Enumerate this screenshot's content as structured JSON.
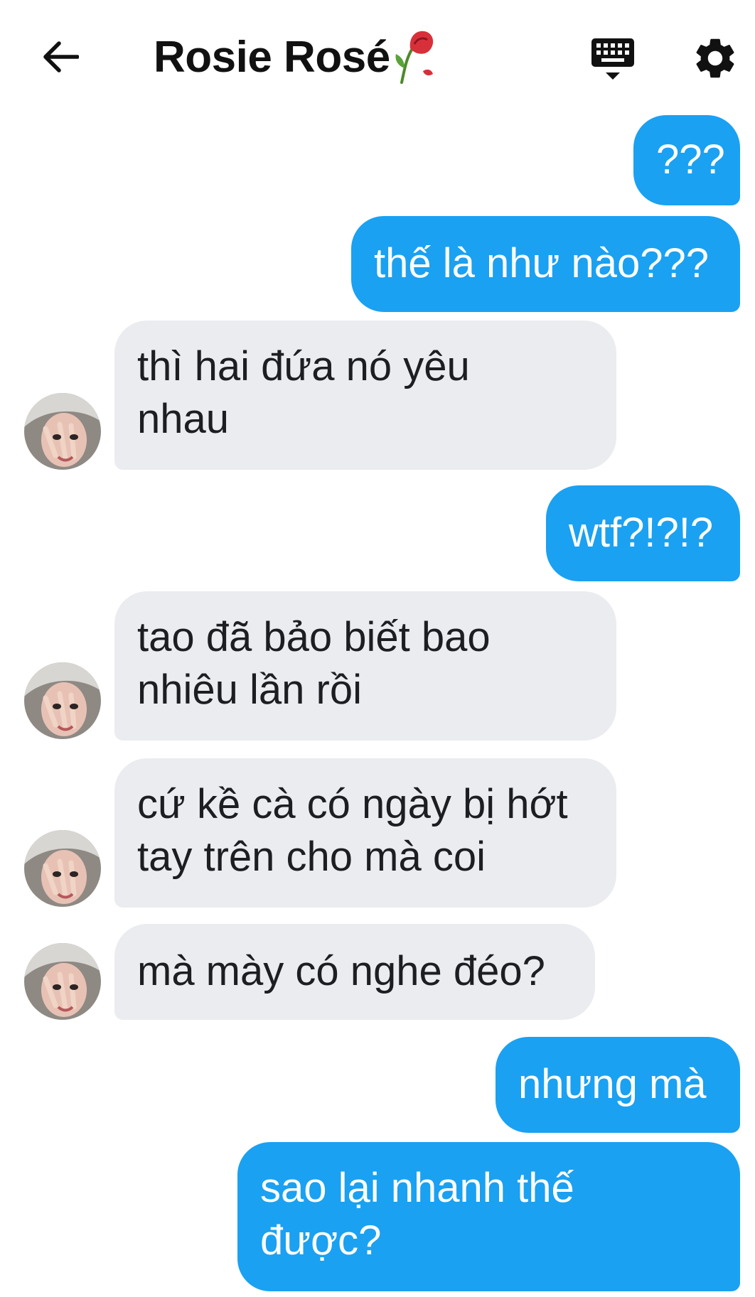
{
  "header": {
    "title": "Rosie Rosé",
    "back_icon": "arrow-left-icon",
    "title_emoji": "wilted-rose-icon",
    "keyboard_icon": "keyboard-icon",
    "settings_icon": "gear-icon"
  },
  "colors": {
    "outgoing_bubble": "#1aa1f2",
    "incoming_bubble": "#eaecf0",
    "header_icons": "#111111"
  },
  "messages": [
    {
      "side": "out",
      "text": "???"
    },
    {
      "side": "out",
      "text": "thế là như nào???"
    },
    {
      "side": "in",
      "lines": [
        "thì hai đứa nó yêu",
        "nhau"
      ]
    },
    {
      "side": "out",
      "text": "wtf?!?!?"
    },
    {
      "side": "in",
      "lines": [
        "tao đã bảo biết bao",
        "nhiêu lần rồi"
      ]
    },
    {
      "side": "in",
      "lines": [
        "cứ kề cà có ngày bị hớt",
        "tay trên cho mà coi"
      ]
    },
    {
      "side": "in",
      "text": "mà mày có nghe đéo?"
    },
    {
      "side": "out",
      "text": "nhưng mà"
    },
    {
      "side": "out",
      "lines": [
        "sao lại nhanh thế",
        "được?"
      ]
    }
  ]
}
